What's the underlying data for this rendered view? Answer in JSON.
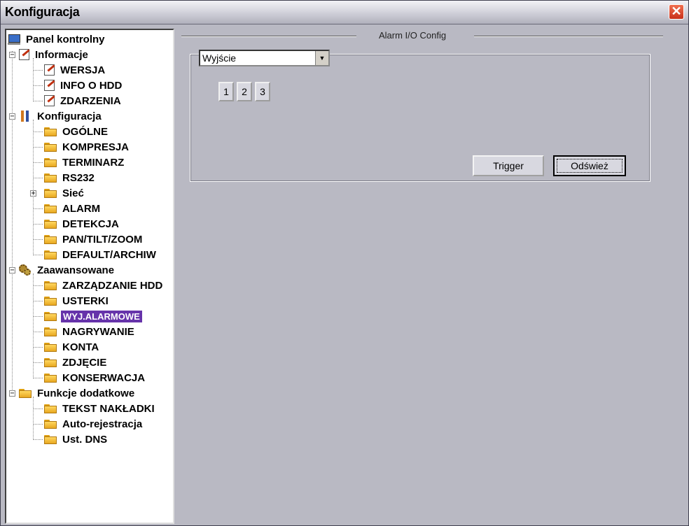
{
  "window": {
    "title": "Konfiguracja"
  },
  "tree": {
    "root": "Panel kontrolny",
    "informacje": {
      "label": "Informacje",
      "items": [
        "WERSJA",
        "INFO O HDD",
        "ZDARZENIA"
      ]
    },
    "konfiguracja": {
      "label": "Konfiguracja",
      "items": [
        "OGÓLNE",
        "KOMPRESJA",
        "TERMINARZ",
        "RS232",
        "Sieć",
        "ALARM",
        "DETEKCJA",
        "PAN/TILT/ZOOM",
        "DEFAULT/ARCHIW"
      ]
    },
    "zaawansowane": {
      "label": "Zaawansowane",
      "items": [
        "ZARZĄDZANIE HDD",
        "USTERKI",
        "WYJ.ALARMOWE",
        "NAGRYWANIE",
        "KONTA",
        "ZDJĘCIE",
        "KONSERWACJA"
      ]
    },
    "funkcje": {
      "label": "Funkcje dodatkowe",
      "items": [
        "TEKST NAKŁADKI",
        "Auto-rejestracja",
        "Ust. DNS"
      ]
    },
    "selected": "WYJ.ALARMOWE"
  },
  "panel": {
    "group_title": "Alarm I/O Config",
    "mode_select": {
      "value": "Wyjście"
    },
    "channels": [
      "1",
      "2",
      "3"
    ],
    "trigger_label": "Trigger",
    "refresh_label": "Odśwież"
  }
}
